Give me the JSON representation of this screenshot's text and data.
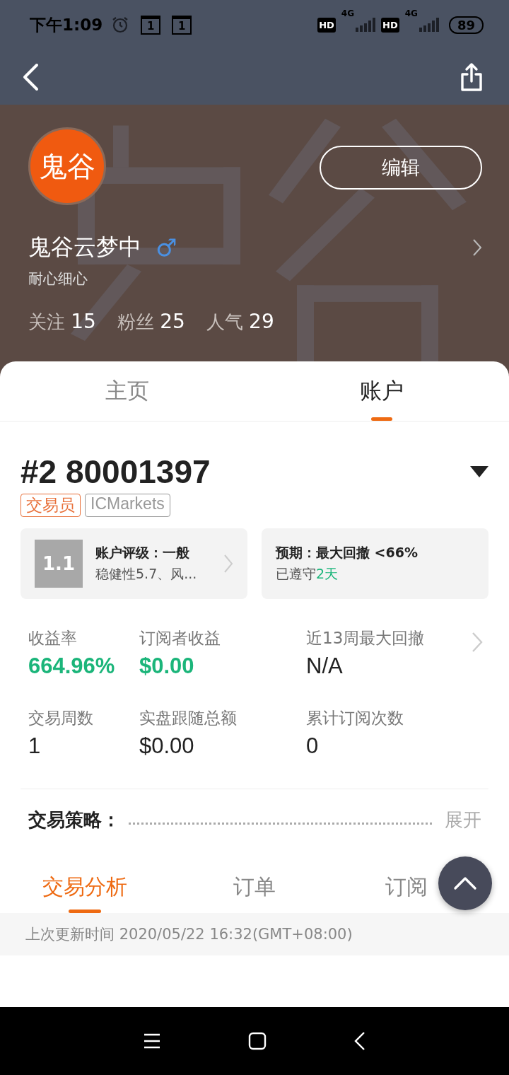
{
  "status_bar": {
    "time": "下午1:09",
    "calendar_days": [
      "1",
      "1"
    ],
    "sims": [
      {
        "hd": "HD",
        "network": "4G"
      },
      {
        "hd": "HD",
        "network": "4G"
      }
    ],
    "battery": "89"
  },
  "profile": {
    "avatar_text": "鬼谷",
    "edit_button": "编辑",
    "name": "鬼谷云梦中",
    "gender_symbol": "♂",
    "bio": "耐心细心",
    "stats": [
      {
        "label": "关注",
        "value": "15"
      },
      {
        "label": "粉丝",
        "value": "25"
      },
      {
        "label": "人气",
        "value": "29"
      }
    ]
  },
  "tabs": [
    {
      "label": "主页",
      "selected": false
    },
    {
      "label": "账户",
      "selected": true
    }
  ],
  "account": {
    "title": "#2 80001397",
    "tags": [
      {
        "label": "交易员",
        "color": "#e8703a"
      },
      {
        "label": "ICMarkets",
        "color": "#999999"
      }
    ],
    "rating": {
      "score": "1.1",
      "title": "账户评级：一般",
      "detail": "稳健性5.7、风..."
    },
    "expectation": {
      "title": "预期：最大回撤 <66%",
      "kept_prefix": "已遵守",
      "kept_days": "2天"
    },
    "metrics": [
      {
        "label": "收益率",
        "value": "664.96%",
        "kind": "green"
      },
      {
        "label": "订阅者收益",
        "value": "$0.00",
        "kind": "green"
      },
      {
        "label": "近13周最大回撤",
        "value": "N/A",
        "kind": "plain"
      },
      {
        "label": "交易周数",
        "value": "1",
        "kind": "plain"
      },
      {
        "label": "实盘跟随总额",
        "value": "$0.00",
        "kind": "plain"
      },
      {
        "label": "累计订阅次数",
        "value": "0",
        "kind": "plain"
      }
    ],
    "strategy": {
      "label": "交易策略：",
      "expand": "展开"
    }
  },
  "sub_tabs": [
    {
      "label": "交易分析",
      "selected": true
    },
    {
      "label": "订单",
      "selected": false
    },
    {
      "label": "订阅",
      "selected": false
    }
  ],
  "updated": "上次更新时间 2020/05/22 16:32(GMT+08:00)"
}
